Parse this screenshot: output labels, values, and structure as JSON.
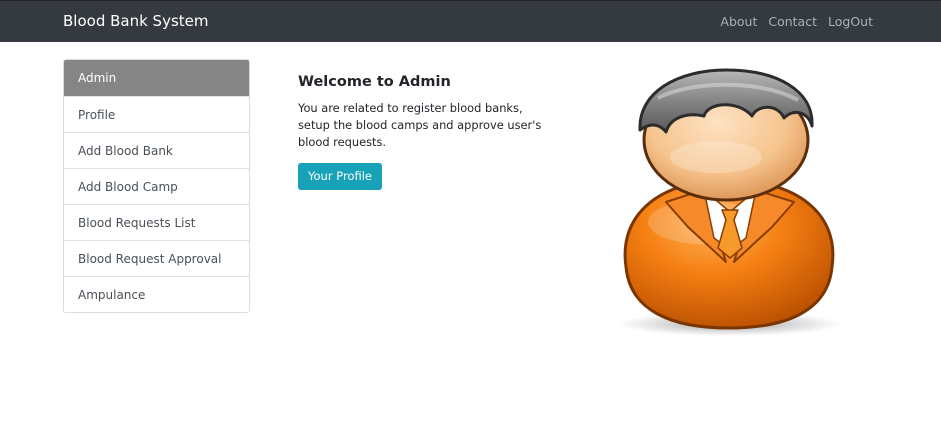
{
  "navbar": {
    "brand": "Blood Bank System",
    "links": [
      "About",
      "Contact",
      "LogOut"
    ]
  },
  "sidebar": {
    "items": [
      {
        "label": "Admin",
        "active": true
      },
      {
        "label": "Profile"
      },
      {
        "label": "Add Blood Bank"
      },
      {
        "label": "Add Blood Camp"
      },
      {
        "label": "Blood Requests List"
      },
      {
        "label": "Blood Request Approval"
      },
      {
        "label": "Ampulance"
      }
    ]
  },
  "main": {
    "title": "Welcome to Admin",
    "description": "You are related to register blood banks, setup the blood camps and approve user's blood requests.",
    "button_label": "Your Profile"
  },
  "colors": {
    "navbar_bg": "#343a40",
    "active_item_bg": "#858585",
    "button_bg": "#17a2b8",
    "avatar_body": "#f07c12"
  },
  "image": {
    "icon": "admin-user-avatar"
  }
}
